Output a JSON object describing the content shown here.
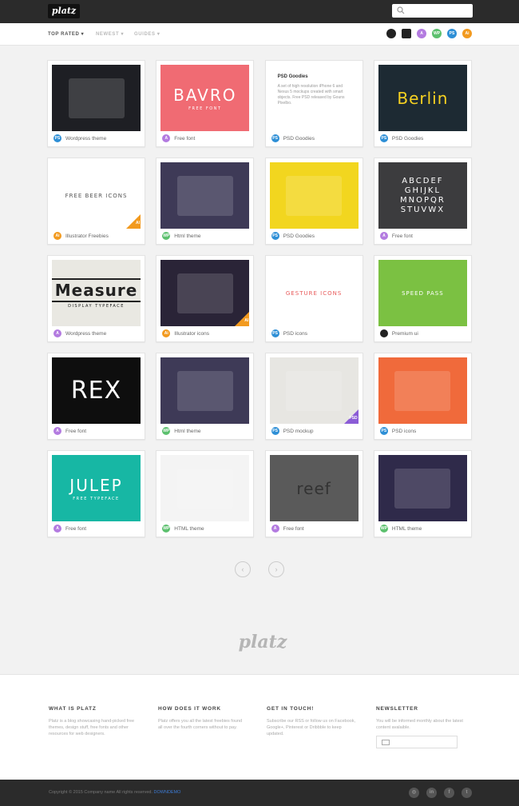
{
  "header": {
    "logo": "platz"
  },
  "subnav": {
    "tabs": [
      {
        "label": "TOP RATED",
        "active": true
      },
      {
        "label": "NEWEST",
        "active": false
      },
      {
        "label": "GUIDES",
        "active": false
      }
    ],
    "filters": [
      {
        "icon": "premium-icon",
        "label": "",
        "color": "#222222"
      },
      {
        "icon": "image-icon",
        "label": "",
        "color": "#222222"
      },
      {
        "icon": "font-icon",
        "label": "A",
        "color": "#b37be0"
      },
      {
        "icon": "wp-icon",
        "label": "WP",
        "color": "#5cc06e"
      },
      {
        "icon": "psd-icon",
        "label": "PS",
        "color": "#2e8fd6"
      },
      {
        "icon": "ai-icon",
        "label": "Ai",
        "color": "#f29a1f"
      }
    ]
  },
  "cards": [
    {
      "caption": "Wordpress theme",
      "badge": "PS",
      "badge_color": "#2e8fd6",
      "thumb_text": "",
      "bg": "#1e1f24",
      "fg": "#ffffff"
    },
    {
      "caption": "Free font",
      "badge": "A",
      "badge_color": "#b37be0",
      "thumb_text": "BAVRO",
      "sub_text": "FREE FONT",
      "bg": "#f06b73",
      "fg": "#ffffff"
    },
    {
      "caption": "PSD Goodies",
      "badge": "PS",
      "badge_color": "#2e8fd6",
      "thumb_text": "",
      "bg": "#ffffff",
      "fg": "#333333",
      "text_title": "PSD Goodies",
      "text_body": "A set of high resolution iPhone 6 and Nexus 5 mockups created with smart objects. Free PSD released by Gouns Pixelbo."
    },
    {
      "caption": "PSD Goodies",
      "badge": "PS",
      "badge_color": "#2e8fd6",
      "thumb_text": "Berlin",
      "bg": "#1d2a33",
      "fg": "#f7d221"
    },
    {
      "caption": "Illustrator Freebies",
      "badge": "Ai",
      "badge_color": "#f29a1f",
      "thumb_text": "FREE BEER ICONS",
      "bg": "#ffffff",
      "fg": "#555555",
      "corner": "AI"
    },
    {
      "caption": "Html theme",
      "badge": "WP",
      "badge_color": "#5cc06e",
      "thumb_text": "",
      "bg": "#3e3a57",
      "fg": "#ffffff"
    },
    {
      "caption": "PSD Goodies",
      "badge": "PS",
      "badge_color": "#2e8fd6",
      "thumb_text": "",
      "bg": "#f2d61f",
      "fg": "#1e3d72"
    },
    {
      "caption": "Free font",
      "badge": "A",
      "badge_color": "#b37be0",
      "thumb_text": "ABCDEF GHIJKL MNOPQR STUVWX",
      "bg": "#3c3c3e",
      "fg": "#ffffff"
    },
    {
      "caption": "Wordpress theme",
      "badge": "A",
      "badge_color": "#b37be0",
      "thumb_text": "Measure",
      "sub_text": "DISPLAY TYPEFACE",
      "bg": "#e9e8e2",
      "fg": "#222222"
    },
    {
      "caption": "Illustrator icons",
      "badge": "Ai",
      "badge_color": "#f29a1f",
      "thumb_text": "",
      "bg": "#2a2437",
      "fg": "#f0714f",
      "corner": "AI"
    },
    {
      "caption": "PSD icons",
      "badge": "PS",
      "badge_color": "#2e8fd6",
      "thumb_text": "GESTURE ICONS",
      "bg": "#ffffff",
      "fg": "#e85b5b"
    },
    {
      "caption": "Premium ui",
      "badge": "",
      "badge_color": "#222222",
      "thumb_text": "SPEED PASS",
      "bg": "#7bc142",
      "fg": "#ffffff"
    },
    {
      "caption": "Free font",
      "badge": "A",
      "badge_color": "#b37be0",
      "thumb_text": "REX",
      "bg": "#0e0e0e",
      "fg": "#ffffff"
    },
    {
      "caption": "Html theme",
      "badge": "WP",
      "badge_color": "#5cc06e",
      "thumb_text": "",
      "bg": "#3e3a57",
      "fg": "#ffffff"
    },
    {
      "caption": "PSD mockup",
      "badge": "PS",
      "badge_color": "#2e8fd6",
      "thumb_text": "",
      "bg": "#e7e6e2",
      "fg": "#333333",
      "corner": "PSD"
    },
    {
      "caption": "PSD icons",
      "badge": "PS",
      "badge_color": "#2e8fd6",
      "thumb_text": "",
      "bg": "#f06a3b",
      "fg": "#ffffff"
    },
    {
      "caption": "Free font",
      "badge": "A",
      "badge_color": "#b37be0",
      "thumb_text": "JULEP",
      "sub_text": "FREE TYPEFACE",
      "bg": "#17b7a4",
      "fg": "#ffffff"
    },
    {
      "caption": "HTML theme",
      "badge": "WP",
      "badge_color": "#5cc06e",
      "thumb_text": "",
      "bg": "#f4f4f4",
      "fg": "#333333"
    },
    {
      "caption": "Free font",
      "badge": "A",
      "badge_color": "#b37be0",
      "thumb_text": "reef",
      "bg": "#5a5a5a",
      "fg": "#333333"
    },
    {
      "caption": "HTML theme",
      "badge": "WP",
      "badge_color": "#5cc06e",
      "thumb_text": "",
      "bg": "#2f2a4a",
      "fg": "#ffffff"
    }
  ],
  "pager": {
    "prev": "‹",
    "next": "›"
  },
  "footer_logo": "platz",
  "footer": {
    "cols": [
      {
        "title": "WHAT IS PLATZ",
        "text": "Platz is a blog showcasing hand-picked free themes, design stuff, free fonts and other resources for web designers."
      },
      {
        "title": "HOW DOES IT WORK",
        "text": "Platz offers you all the latest freebies found all over the fourth corners without to pay."
      },
      {
        "title": "GET IN TOUCH!",
        "text": "Subscribe our RSS or follow us on Facebook, Google+, Pinterest or Dribbble to keep updated."
      },
      {
        "title": "NEWSLETTER",
        "text": "You will be informed monthly about the latest content avalaible."
      }
    ],
    "copyright": "Copyright © 2015 Company name All rights reserved.",
    "copyright_link": "DOWNDEMO",
    "social": [
      "◎",
      "in",
      "f",
      "t"
    ]
  }
}
